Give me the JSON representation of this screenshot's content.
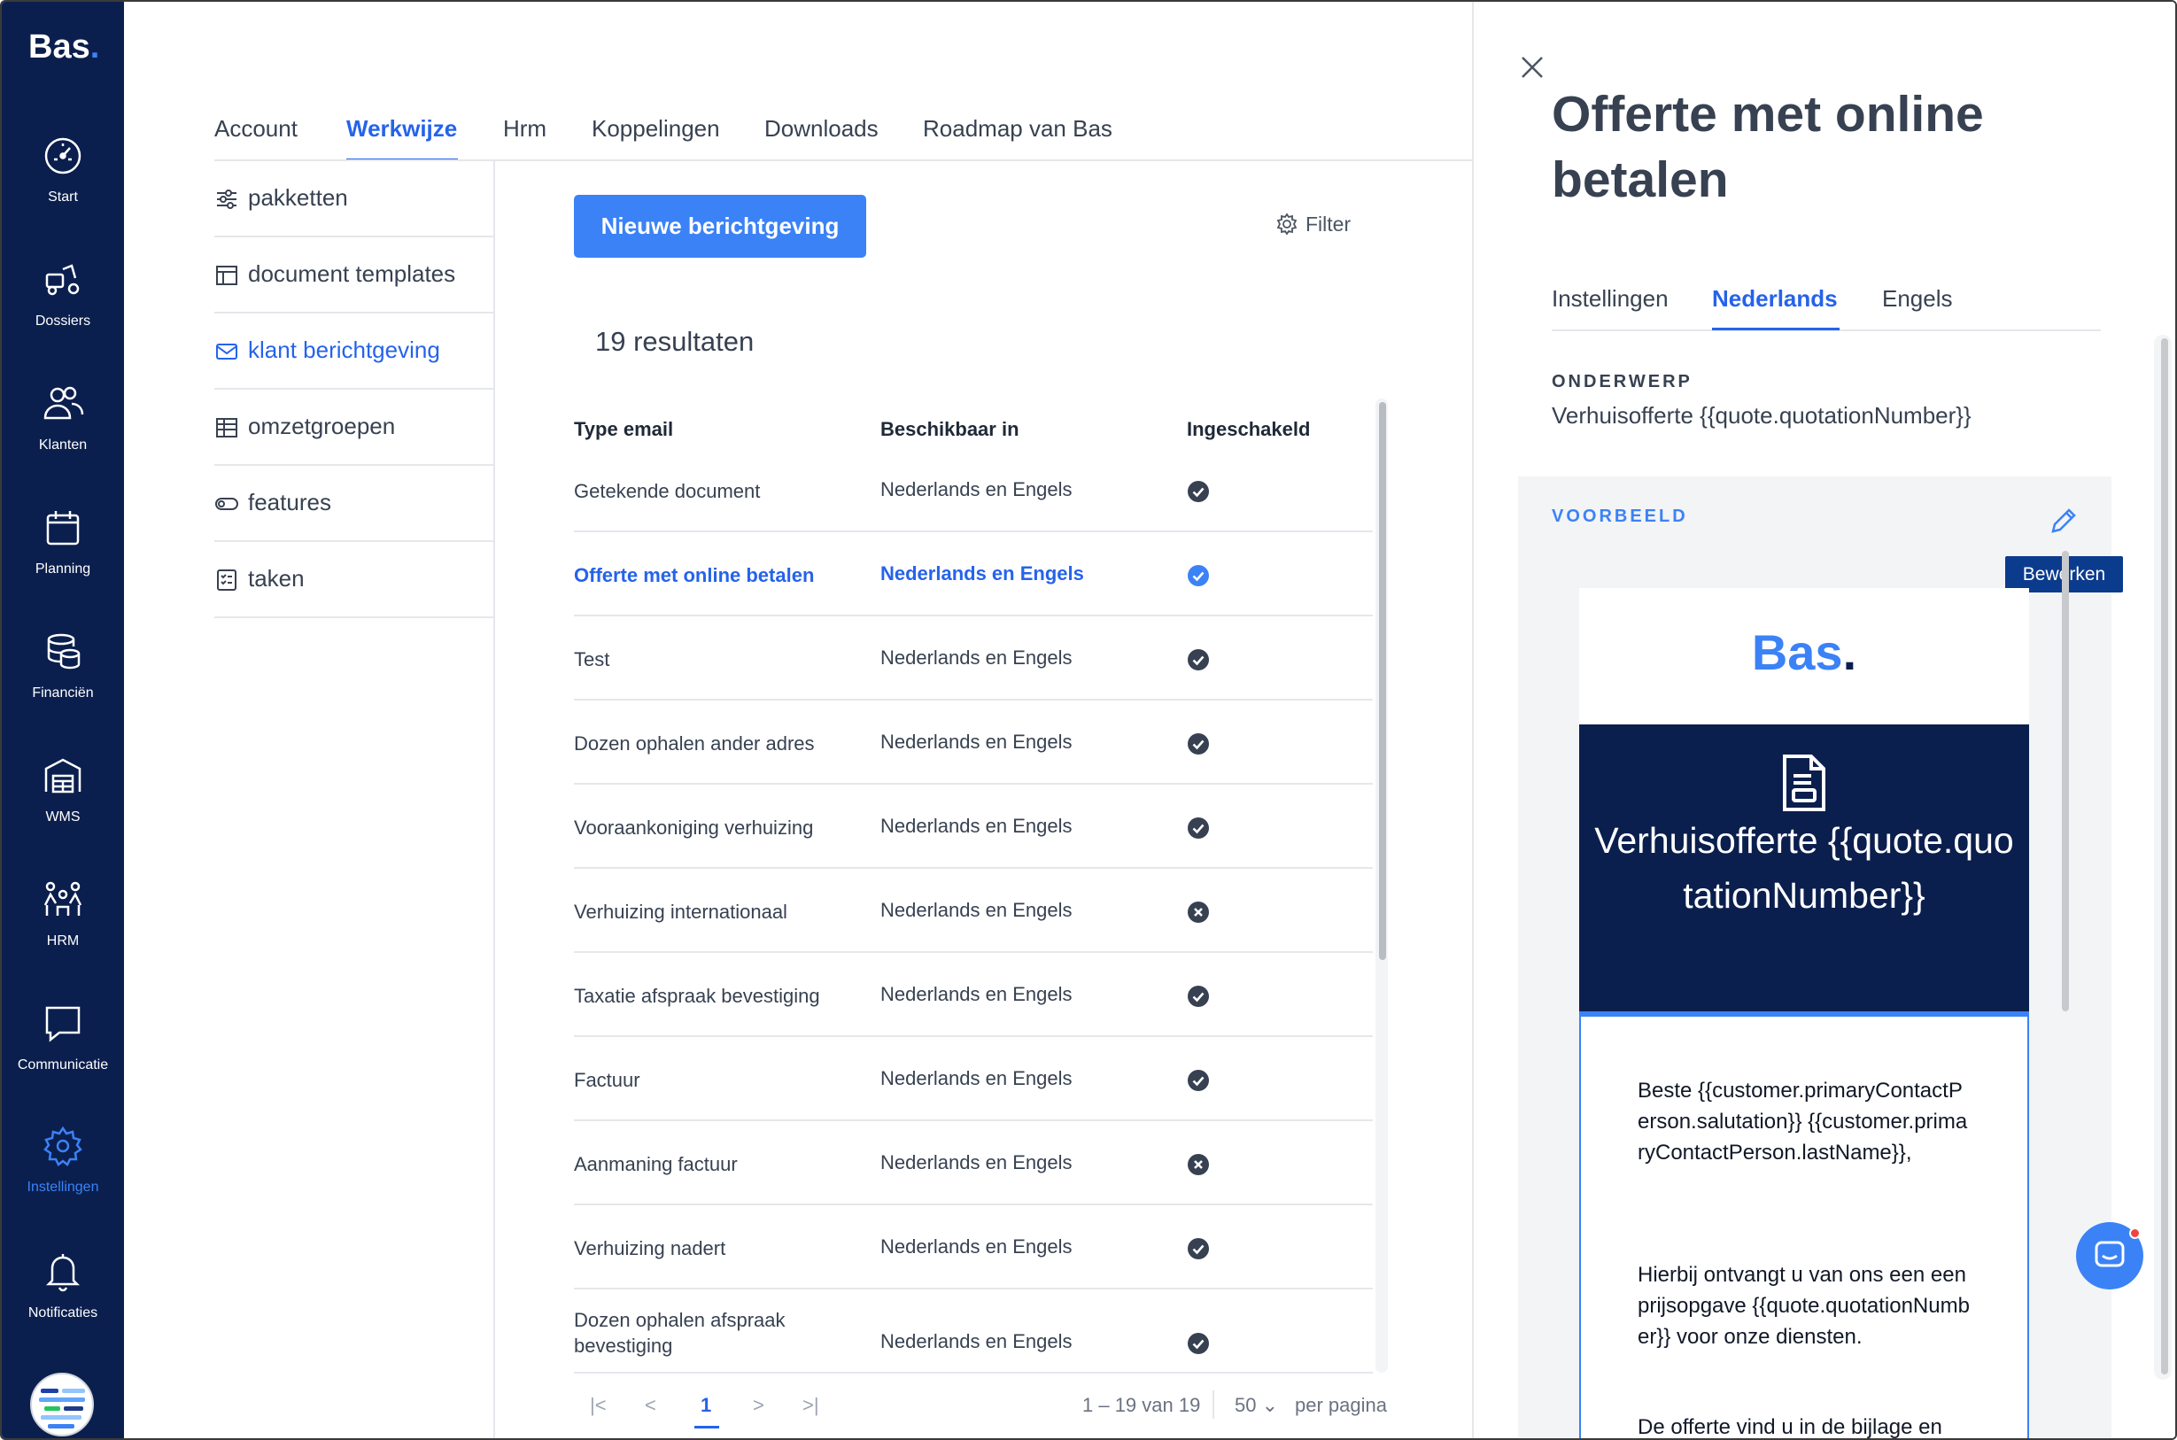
{
  "app": {
    "brand": "Bas",
    "brand_dot": "."
  },
  "sidebar": {
    "items": [
      {
        "label": "Start",
        "icon": "gauge-icon"
      },
      {
        "label": "Dossiers",
        "icon": "truck-icon"
      },
      {
        "label": "Klanten",
        "icon": "users-icon"
      },
      {
        "label": "Planning",
        "icon": "calendar-icon"
      },
      {
        "label": "Financiën",
        "icon": "coins-icon"
      },
      {
        "label": "WMS",
        "icon": "warehouse-icon"
      },
      {
        "label": "HRM",
        "icon": "team-icon"
      },
      {
        "label": "Communicatie",
        "icon": "chat-bubble-icon"
      },
      {
        "label": "Instellingen",
        "icon": "gear-icon",
        "active": true
      },
      {
        "label": "Notificaties",
        "icon": "bell-icon"
      }
    ]
  },
  "top_tabs": [
    "Account",
    "Werkwijze",
    "Hrm",
    "Koppelingen",
    "Downloads",
    "Roadmap van Bas"
  ],
  "top_tabs_active": "Werkwijze",
  "submenu": [
    {
      "label": "pakketten",
      "icon": "sliders-icon"
    },
    {
      "label": "document templates",
      "icon": "layout-icon"
    },
    {
      "label": "klant berichtgeving",
      "icon": "envelope-icon",
      "active": true
    },
    {
      "label": "omzetgroepen",
      "icon": "table-icon"
    },
    {
      "label": "features",
      "icon": "toggle-icon"
    },
    {
      "label": "taken",
      "icon": "checklist-icon"
    }
  ],
  "main": {
    "new_button": "Nieuwe berichtgeving",
    "filter_label": "Filter",
    "results": "19 resultaten",
    "columns": [
      "Type email",
      "Beschikbaar in",
      "Ingeschakeld"
    ],
    "rows": [
      {
        "type": "Getekende document",
        "available": "Nederlands en Engels",
        "enabled": true
      },
      {
        "type": "Offerte met online betalen",
        "available": "Nederlands en Engels",
        "enabled": true,
        "active": true
      },
      {
        "type": "Test",
        "available": "Nederlands en Engels",
        "enabled": true
      },
      {
        "type": "Dozen ophalen ander adres",
        "available": "Nederlands en Engels",
        "enabled": true
      },
      {
        "type": "Vooraankoniging verhuizing",
        "available": "Nederlands en Engels",
        "enabled": true
      },
      {
        "type": "Verhuizing internationaal",
        "available": "Nederlands en Engels",
        "enabled": false
      },
      {
        "type": "Taxatie afspraak bevestiging",
        "available": "Nederlands en Engels",
        "enabled": true
      },
      {
        "type": "Factuur",
        "available": "Nederlands en Engels",
        "enabled": true
      },
      {
        "type": "Aanmaning factuur",
        "available": "Nederlands en Engels",
        "enabled": false
      },
      {
        "type": "Verhuizing nadert",
        "available": "Nederlands en Engels",
        "enabled": true
      },
      {
        "type": "Dozen ophalen afspraak bevestiging",
        "available": "Nederlands en Engels",
        "enabled": true
      }
    ],
    "pagination": {
      "first": "|<",
      "prev": "<",
      "current": "1",
      "next": ">",
      "last": ">|",
      "range": "1 – 19 van 19",
      "page_size": "50",
      "per_page_label": "per pagina"
    }
  },
  "panel": {
    "title": "Offerte met online betalen",
    "tabs": [
      "Instellingen",
      "Nederlands",
      "Engels"
    ],
    "active_tab": "Nederlands",
    "subject_label": "ONDERWERP",
    "subject": "Verhuisofferte {{quote.quotationNumber}}",
    "preview_label": "VOORBEELD",
    "edit_tooltip": "Bewerken",
    "email": {
      "logo": "Bas",
      "logo_dot": ".",
      "hero_title": "Verhuisofferte {{quote.quotationNumber}}",
      "greeting": "Beste {{customer.primaryContactPerson.salutation}} {{customer.primaryContactPerson.lastName}},",
      "paragraph1": "Hierbij ontvangt u van ons een een prijsopgave {{quote.quotationNumber}} voor onze diensten.",
      "paragraph2": "De offerte vind u in de bijlage en"
    }
  },
  "colors": {
    "sidebar_bg": "#0b1f4e",
    "accent": "#3b82f6",
    "accent_text": "#2563eb",
    "tooltip_bg": "#0b3b8c"
  }
}
